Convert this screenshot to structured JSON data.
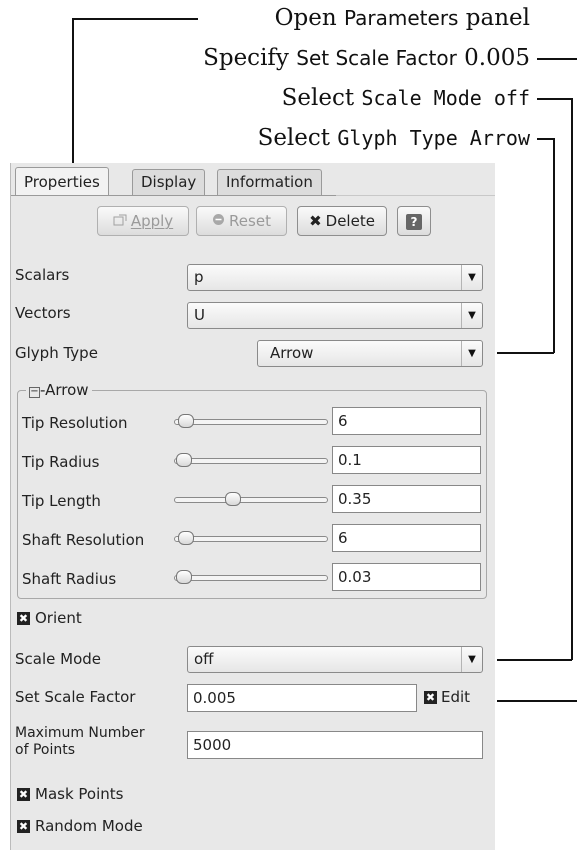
{
  "annotations": [
    {
      "pre": "Open ",
      "kw": "Parameters",
      "post": " panel",
      "kind": "kw"
    },
    {
      "pre": "Specify ",
      "kw": "Set Scale Factor",
      "post": " 0.005",
      "kind": "kw"
    },
    {
      "pre": "Select ",
      "kw": "Scale Mode off",
      "post": "",
      "kind": "mono"
    },
    {
      "pre": "Select ",
      "kw": "Glyph Type Arrow",
      "post": "",
      "kind": "mono"
    }
  ],
  "tabs": [
    "Properties",
    "Display",
    "Information"
  ],
  "buttons": {
    "apply": "Apply",
    "reset": "Reset",
    "delete": "Delete",
    "help": "?"
  },
  "fields": {
    "scalars_label": "Scalars",
    "scalars_value": "p",
    "vectors_label": "Vectors",
    "vectors_value": "U",
    "glyph_type_label": "Glyph Type",
    "glyph_type_value": "Arrow"
  },
  "arrow_group": {
    "title": "Arrow",
    "rows": [
      {
        "label": "Tip Resolution",
        "value": "6"
      },
      {
        "label": "Tip Radius",
        "value": "0.1"
      },
      {
        "label": "Tip Length",
        "value": "0.35"
      },
      {
        "label": "Shaft Resolution",
        "value": "6"
      },
      {
        "label": "Shaft Radius",
        "value": "0.03"
      }
    ]
  },
  "orient_label": "Orient",
  "scale_mode": {
    "label": "Scale Mode",
    "value": "off"
  },
  "scale_factor": {
    "label": "Set Scale Factor",
    "value": "0.005",
    "edit_label": "Edit"
  },
  "max_points": {
    "label_line1": "Maximum Number",
    "label_line2": "of Points",
    "value": "5000"
  },
  "mask_points_label": "Mask Points",
  "random_mode_label": "Random Mode",
  "icons": {
    "apply": "apply-icon",
    "reset": "reset-icon",
    "delete": "delete-icon",
    "help": "help-icon",
    "check": "checkmark-icon",
    "dropdown": "chevron-down-icon"
  }
}
